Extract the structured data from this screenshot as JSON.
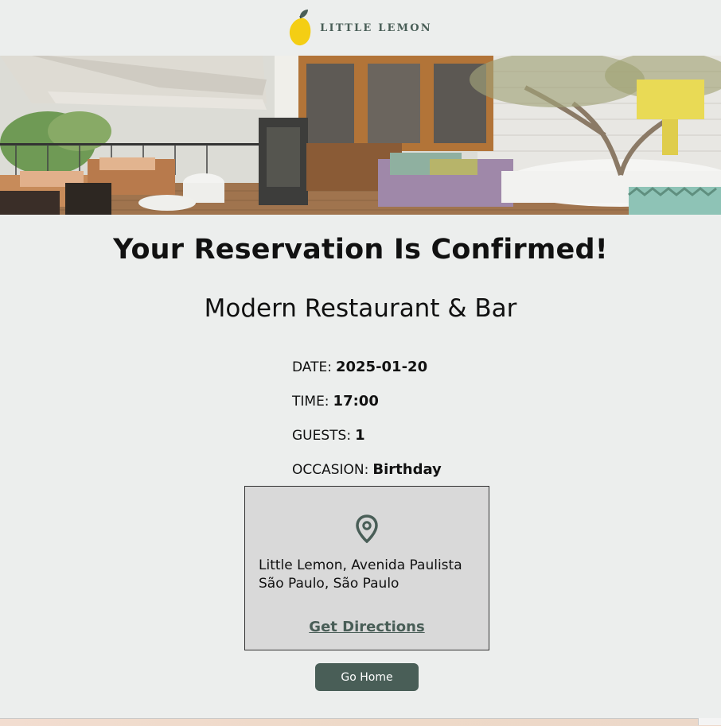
{
  "header": {
    "logo_text": "LITTLE LEMON",
    "logo_icon": "lemon-icon"
  },
  "hero": {
    "description_icon": "restaurant-terrace-image"
  },
  "confirmation": {
    "title": "Your Reservation Is Confirmed!",
    "subtitle": "Modern Restaurant & Bar",
    "details": [
      {
        "label": "DATE:",
        "value": "2025-01-20"
      },
      {
        "label": "TIME:",
        "value": "17:00"
      },
      {
        "label": "GUESTS:",
        "value": "1"
      },
      {
        "label": "OCCASION:",
        "value": "Birthday"
      }
    ]
  },
  "location": {
    "icon": "map-pin-icon",
    "address_line1": "Little Lemon, Avenida Paulista",
    "address_line2": "São Paulo, São Paulo",
    "directions_label": "Get Directions"
  },
  "actions": {
    "go_home_label": "Go Home"
  },
  "colors": {
    "brand_green": "#495e57",
    "lemon_yellow": "#f4ce14",
    "background": "#eceeed",
    "card": "#d9d9d9"
  }
}
